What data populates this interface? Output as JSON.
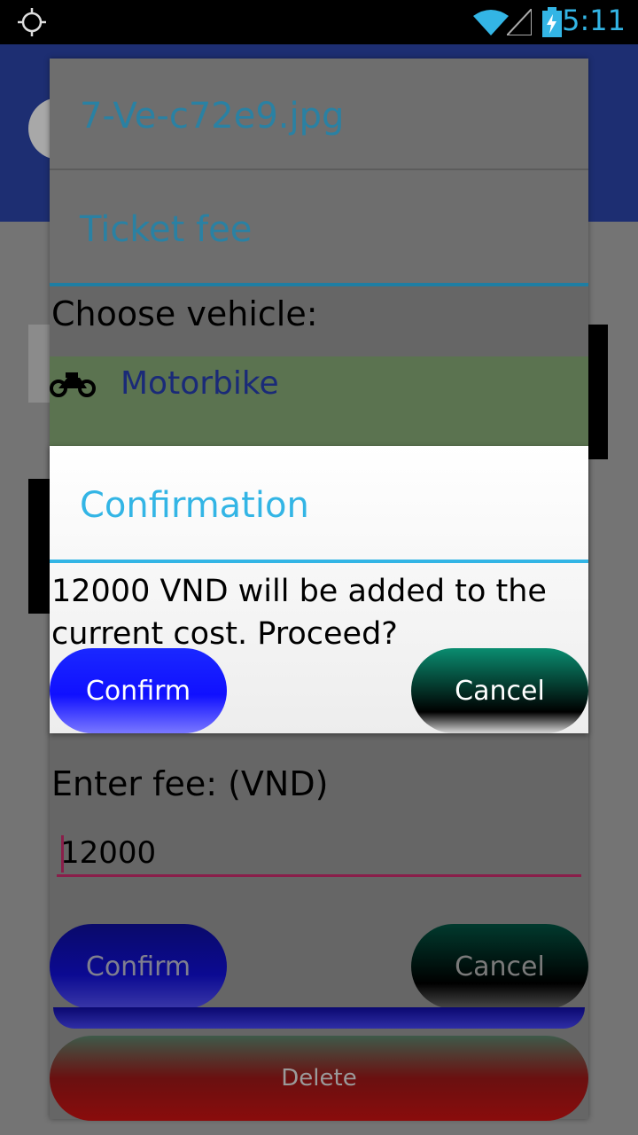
{
  "status_bar": {
    "time": "5:11",
    "icons": [
      "gps-icon",
      "wifi-icon",
      "signal-icon",
      "battery-charging-icon"
    ]
  },
  "dialog": {
    "filename": "7-Ve-c72e9.jpg",
    "title": "Ticket fee",
    "choose_label": "Choose vehicle:",
    "vehicle": {
      "icon": "motorbike-icon",
      "label": "Motorbike"
    },
    "fee_label": "Enter fee: (VND)",
    "fee_value": "12000",
    "confirm_label": "Confirm",
    "cancel_label": "Cancel",
    "delete_label": "Delete"
  },
  "confirmation": {
    "title": "Confirmation",
    "message": "12000 VND will be added to the current cost. Proceed?",
    "confirm_label": "Confirm",
    "cancel_label": "Cancel"
  },
  "colors": {
    "accent": "#33b5e5",
    "vehicle_row": "#5b7350",
    "input_underline": "#8a1e4a"
  }
}
